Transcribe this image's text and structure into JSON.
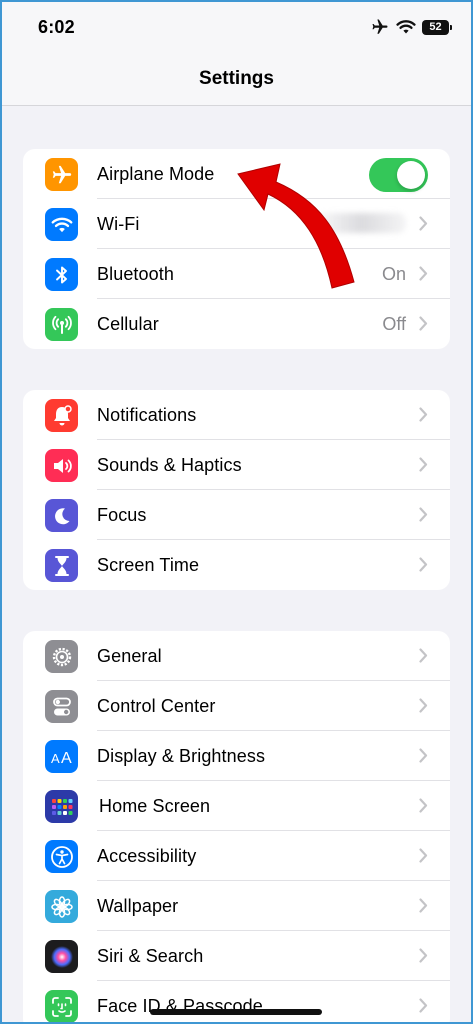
{
  "status_bar": {
    "time": "6:02",
    "battery_level": "52"
  },
  "nav": {
    "title": "Settings"
  },
  "groups": [
    {
      "rows": [
        {
          "label": "Airplane Mode",
          "icon": "airplane-icon",
          "icon_color": "#ff9500",
          "control": "toggle",
          "toggle_on": true
        },
        {
          "label": "Wi-Fi",
          "icon": "wifi-icon",
          "icon_color": "#007aff",
          "value": ""
        },
        {
          "label": "Bluetooth",
          "icon": "bluetooth-icon",
          "icon_color": "#007aff",
          "value": "On"
        },
        {
          "label": "Cellular",
          "icon": "cellular-icon",
          "icon_color": "#34c759",
          "value": "Off"
        }
      ]
    },
    {
      "rows": [
        {
          "label": "Notifications",
          "icon": "bell-icon",
          "icon_color": "#ff3b30"
        },
        {
          "label": "Sounds & Haptics",
          "icon": "speaker-icon",
          "icon_color": "#ff2d55"
        },
        {
          "label": "Focus",
          "icon": "moon-icon",
          "icon_color": "#5856d6"
        },
        {
          "label": "Screen Time",
          "icon": "hourglass-icon",
          "icon_color": "#5856d6"
        }
      ]
    },
    {
      "rows": [
        {
          "label": "General",
          "icon": "gear-icon",
          "icon_color": "#8e8e93"
        },
        {
          "label": "Control Center",
          "icon": "switches-icon",
          "icon_color": "#8e8e93"
        },
        {
          "label": "Display & Brightness",
          "icon": "text-size-icon",
          "icon_color": "#007aff"
        },
        {
          "label": "Home Screen",
          "icon": "app-grid-icon",
          "icon_color": "#2c3aa8"
        },
        {
          "label": "Accessibility",
          "icon": "accessibility-icon",
          "icon_color": "#007aff"
        },
        {
          "label": "Wallpaper",
          "icon": "flower-icon",
          "icon_color": "#34aadc"
        },
        {
          "label": "Siri & Search",
          "icon": "siri-icon",
          "icon_color": "#1c1c1e"
        },
        {
          "label": "Face ID & Passcode",
          "icon": "face-id-icon",
          "icon_color": "#34c759"
        }
      ]
    }
  ],
  "annotation": {
    "arrow_color": "#e00000"
  }
}
